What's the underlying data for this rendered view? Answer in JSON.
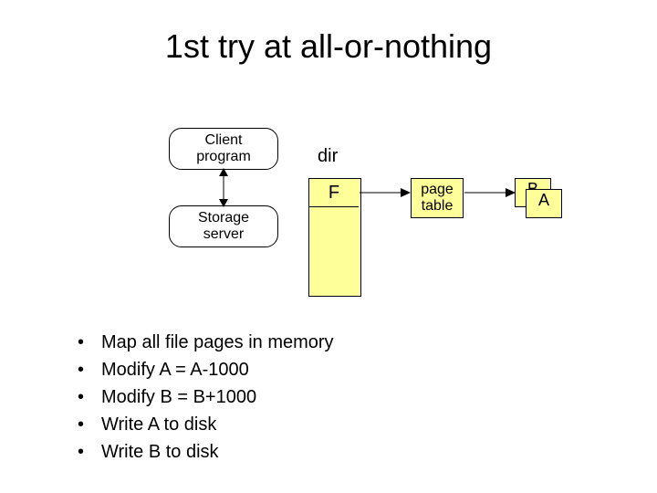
{
  "title": "1st try at all-or-nothing",
  "boxes": {
    "client": "Client\nprogram",
    "storage": "Storage\nserver",
    "dir_label": "dir",
    "dir_cell": "F",
    "page_table": "page\ntable",
    "B": "B",
    "A": "A"
  },
  "bullets": [
    "Map all file pages in memory",
    "Modify A = A-1000",
    "Modify B = B+1000",
    "Write A to disk",
    "Write B to disk"
  ],
  "colors": {
    "box_fill": "#ffff99",
    "box_border": "#000014"
  }
}
